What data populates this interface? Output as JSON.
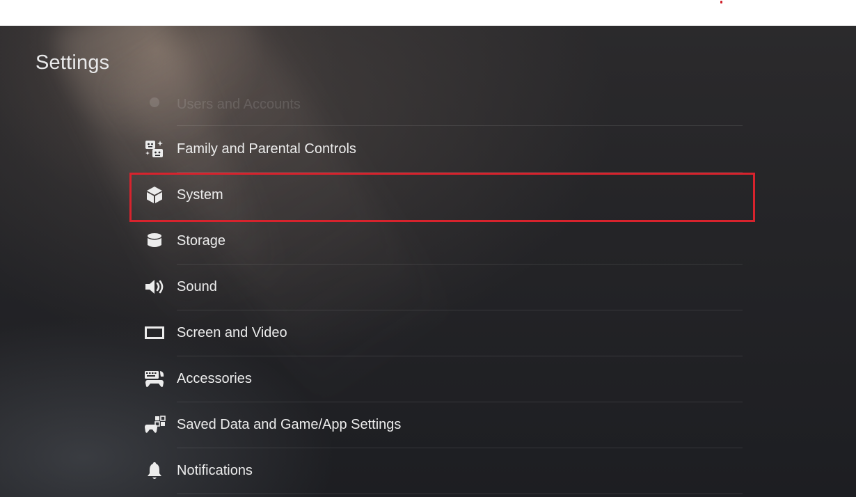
{
  "window": {
    "title": "Settings"
  },
  "settings": {
    "items": [
      {
        "label": "Users and Accounts",
        "icon": "users-icon",
        "state": "partially-scrolled-out"
      },
      {
        "label": "Family and Parental Controls",
        "icon": "family-icon"
      },
      {
        "label": "System",
        "icon": "system-cube-icon",
        "highlighted": true
      },
      {
        "label": "Storage",
        "icon": "storage-icon"
      },
      {
        "label": "Sound",
        "icon": "speaker-icon"
      },
      {
        "label": "Screen and Video",
        "icon": "screen-icon"
      },
      {
        "label": "Accessories",
        "icon": "accessories-icon"
      },
      {
        "label": "Saved Data and Game/App Settings",
        "icon": "saved-data-icon"
      },
      {
        "label": "Notifications",
        "icon": "bell-icon"
      }
    ]
  },
  "colors": {
    "highlight_border": "#d7232d",
    "text": "#ececec",
    "background": "#242427"
  }
}
